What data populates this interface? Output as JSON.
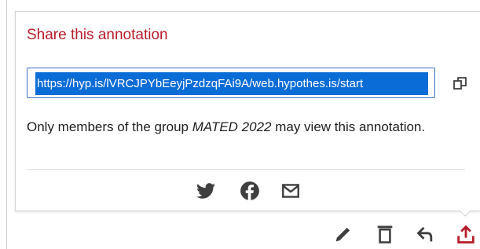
{
  "share": {
    "title": "Share this annotation",
    "url": "https://hyp.is/lVRCJPYbEeyjPzdzqFAi9A/web.hypothes.is/start",
    "visibility_prefix": "Only members of the group ",
    "group_name": "MATED 2022",
    "visibility_suffix": " may view this annotation."
  },
  "icons": {
    "copy": "copy-icon",
    "twitter": "twitter-icon",
    "facebook": "facebook-icon",
    "email": "email-icon",
    "edit": "pencil-icon",
    "delete": "trash-icon",
    "reply": "reply-icon",
    "share": "share-icon"
  },
  "colors": {
    "title": "#b61d2a",
    "accent": "#b61d2a",
    "selection": "#0a6cd6",
    "icon": "#3f3f3f"
  }
}
